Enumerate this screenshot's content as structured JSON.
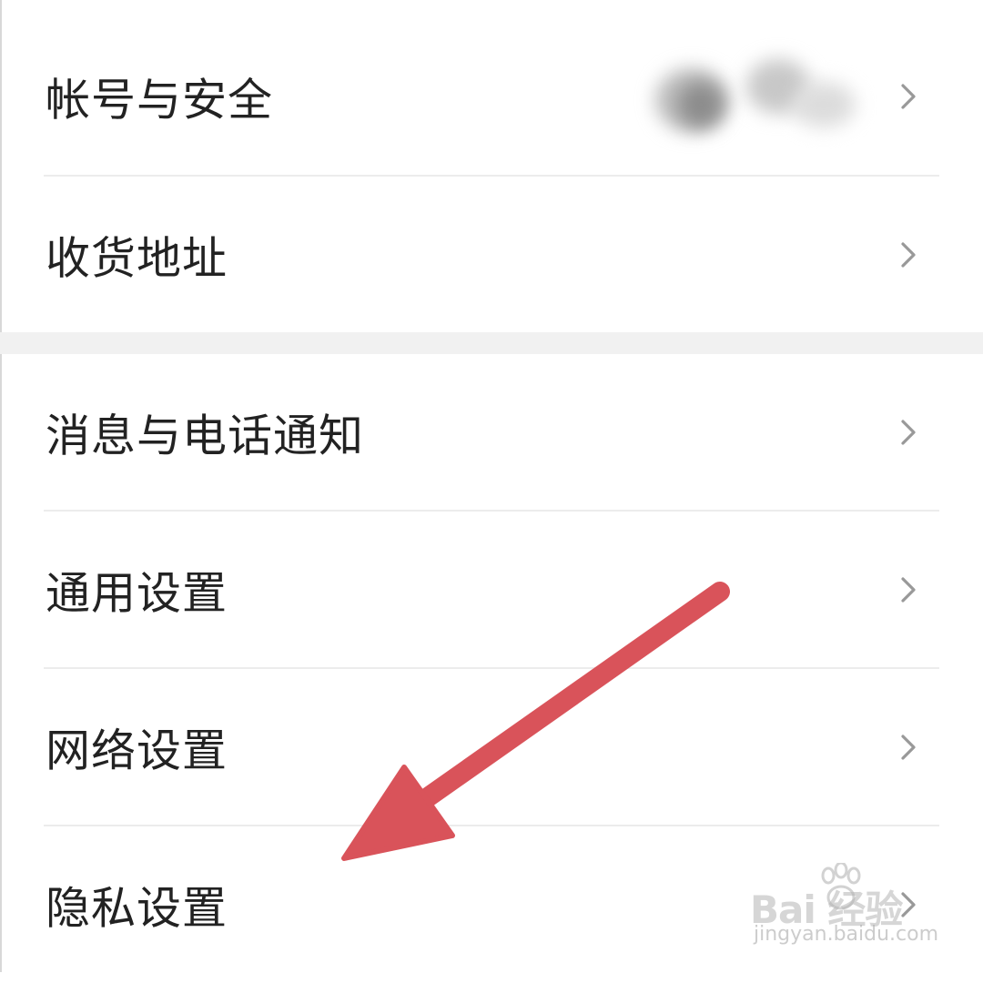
{
  "settings": {
    "section1": [
      {
        "label": "帐号与安全",
        "value_blurred": true
      },
      {
        "label": "收货地址"
      }
    ],
    "section2": [
      {
        "label": "消息与电话通知"
      },
      {
        "label": "通用设置"
      },
      {
        "label": "网络设置"
      },
      {
        "label": "隐私设置"
      }
    ]
  },
  "annotation": {
    "arrow_color": "#d9535a"
  },
  "watermark": {
    "brand": "Bai 经验",
    "url": "jingyan.baidu.com"
  },
  "icons": {
    "row_chevron": "chevron-right-icon"
  },
  "colors": {
    "text": "#222222",
    "chevron": "#999999",
    "divider": "#ececec",
    "section_gap": "#f1f1f1"
  }
}
